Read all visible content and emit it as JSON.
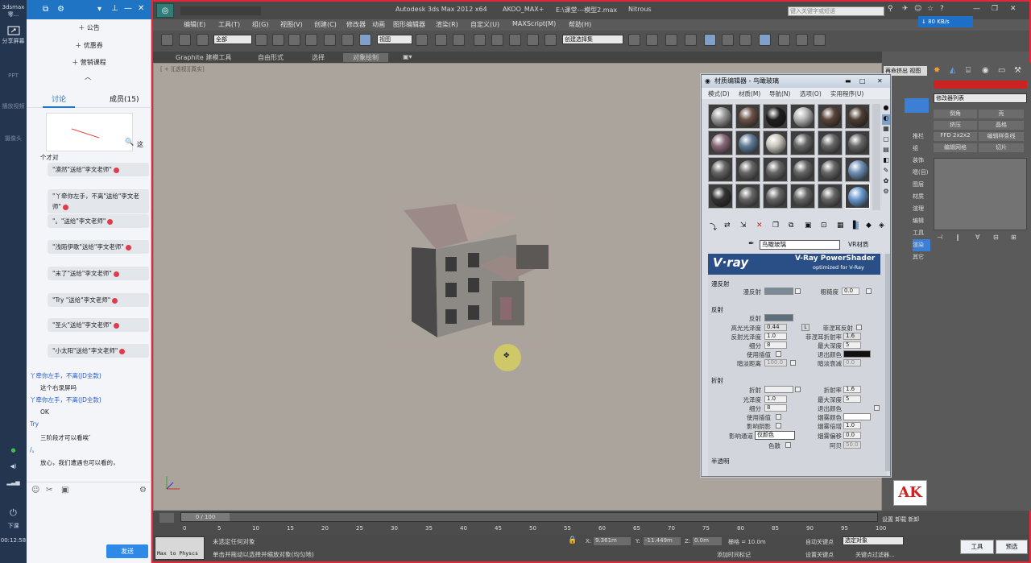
{
  "left_strip": {
    "top_label": "3dsmax零...",
    "share_label": "分享屏幕",
    "ppt_label": "PPT",
    "audio_label": "播放视频",
    "video_label": "摄像头",
    "end_label": "下课",
    "time": "00:12:58"
  },
  "chat": {
    "menu": [
      "公告",
      "优惠券",
      "营销课程"
    ],
    "tabs": {
      "discuss": "讨论",
      "members": "成员(15)"
    },
    "side_word": "这",
    "intro": "个才对",
    "gift_messages": [
      "\"漠然\"送给\"李文老师\"",
      "\"丫牵你左手，不离\"送给\"李文老师\"",
      "\"。\"送给\"李文老师\"",
      "\"浅陌伊歌\"送给\"李文老师\"",
      "\"末了\"送给\"李文老师\"",
      "\"Try        \"送给\"李文老师\"",
      "\"圣火\"送给\"李文老师\"",
      "\"小太阳\"送给\"李文老师\""
    ],
    "lines": [
      {
        "user": "丫牵你左手，不离(JD全款)",
        "text": "这个右录屏吗"
      },
      {
        "user": "丫牵你左手，不离(JD全款)",
        "text": "OK"
      },
      {
        "user": "Try",
        "text": "三阶段才可以看唉゛"
      },
      {
        "user": "/。",
        "text": "放心，我们遭遇也可以看的，"
      }
    ],
    "send": "发送"
  },
  "max": {
    "title": "Autodesk 3ds Max  2012 x64",
    "project": "AKOO_MAX+",
    "file": "E:\\课堂---模型2.max",
    "renderer": "Nitrous",
    "search_placeholder": "键入关键字或短语",
    "net_speed": "↓ 80 KB/s",
    "menus": [
      "编辑(E)",
      "工具(T)",
      "组(G)",
      "视图(V)",
      "创建(C)",
      "修改器",
      "动画",
      "图形编辑器",
      "渲染(R)",
      "自定义(U)",
      "MAXScript(M)",
      "帮助(H)"
    ],
    "filter": "全部",
    "view": "视图",
    "selset": "创建选择集",
    "ribbon_tabs": [
      "Graphite 建模工具",
      "自由形式",
      "选择",
      "对象绘制"
    ],
    "viewport_label": "[ + ][透视][真实]",
    "cmd": {
      "top_labels": [
        "再命挤出",
        "视图"
      ],
      "modlist": "修改器列表",
      "buttons": [
        "倒角",
        "壳",
        "挤压",
        "晶格",
        "FFD 2x2x2",
        "编辑样条线",
        "编辑网格",
        "切片"
      ],
      "side_items": [
        "推栏",
        "组",
        "装饰",
        "嗯(目)",
        "图层",
        "材质",
        "渲理",
        "编辑",
        "工具",
        "渲染",
        "其它"
      ]
    },
    "timeline": {
      "frame": "0 / 100",
      "ticks": [
        "0",
        "5",
        "10",
        "15",
        "20",
        "25",
        "30",
        "35",
        "40",
        "45",
        "50",
        "55",
        "60",
        "65",
        "70",
        "75",
        "80",
        "85",
        "90",
        "95",
        "100"
      ]
    },
    "status": {
      "script_btn": "Max to Physcs",
      "line1": "未选定任何对象",
      "line2": "单击并拖动以选择并缩放对象(均匀地)",
      "x": "9.361m",
      "y": "-11.449m",
      "z": "0.0m",
      "grid": "栅格 = 10.0m",
      "add_time": "添加时间标记",
      "autokey": "自动关键点",
      "selected": "选定对象",
      "setkey": "设置关键点",
      "keyfilter": "关键点过滤器...",
      "tool": "工具",
      "preset": "预选"
    },
    "bottom_right": {
      "labels": [
        "设置",
        "卸载",
        "新卸"
      ],
      "ak": "AK"
    }
  },
  "mated": {
    "title": "材质编辑器 - 鸟瞰玻璃",
    "menus": [
      "模式(D)",
      "材质(M)",
      "导航(N)",
      "选项(O)",
      "实用程序(U)"
    ],
    "mat_name": "鸟瞰玻璃",
    "type": "VR材质",
    "banner": "V-Ray PowerShader",
    "banner_sub": "optimized for V-Ray",
    "diffuse": {
      "section": "漫反射",
      "label": "漫反射",
      "rough_label": "粗糙度",
      "rough": "0.0"
    },
    "reflection": {
      "section": "反射",
      "refl": "反射",
      "hilight": "高光光泽度",
      "hilight_val": "0.44",
      "L": "L",
      "fresnel": "菲涅耳反射",
      "gloss": "反射光泽度",
      "gloss_val": "1.0",
      "fresnel_ior": "菲涅耳折射率",
      "fresnel_ior_val": "1.6",
      "subdiv": "细分",
      "subdiv_val": "8",
      "maxdepth": "最大深度",
      "maxdepth_val": "5",
      "interp": "使用插值",
      "exit": "退出颜色",
      "dimdist": "暗淡距离",
      "dimdist_val": "100.0",
      "dimfall": "暗淡衰减",
      "dimfall_val": "0.0"
    },
    "refraction": {
      "section": "折射",
      "refr": "折射",
      "ior": "折射率",
      "ior_val": "1.6",
      "gloss": "光泽度",
      "gloss_val": "1.0",
      "maxdepth": "最大深度",
      "maxdepth_val": "5",
      "subdiv": "细分",
      "subdiv_val": "8",
      "exit": "退出颜色",
      "interp": "使用插值",
      "fogcol": "烟雾颜色",
      "shadow": "影响阴影",
      "fogmult": "烟雾倍增",
      "fogmult_val": "1.0",
      "channel": "影响通道",
      "channel_val": "仅颜色",
      "fogbias": "烟雾偏移",
      "fogbias_val": "0.0",
      "disp": "色散",
      "abbe": "阿贝",
      "abbe_val": "50.0"
    },
    "translucency": "半透明"
  }
}
